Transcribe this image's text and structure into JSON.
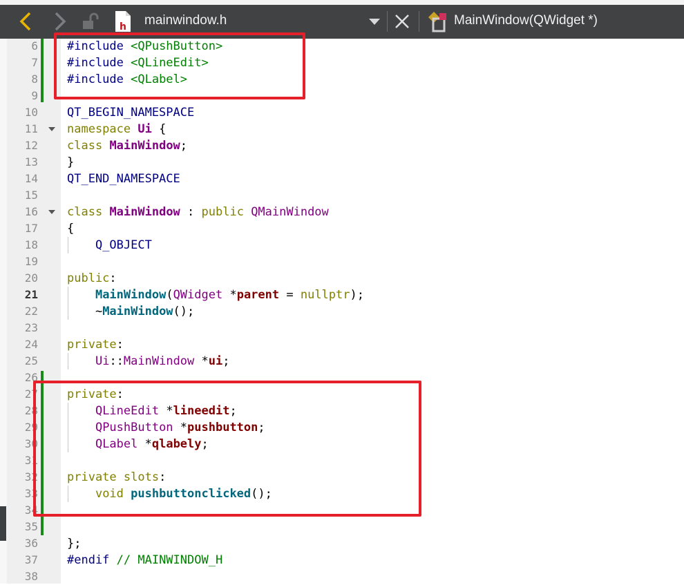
{
  "toolbar": {
    "file_name": "mainwindow.h",
    "symbol": "MainWindow(QWidget *)",
    "icons": [
      "back-arrow-icon",
      "forward-arrow-icon",
      "unlock-icon",
      "header-file-icon",
      "dropdown-icon",
      "close-icon",
      "class-symbol-icon"
    ]
  },
  "editor": {
    "current_line": 21,
    "lines": [
      {
        "n": "6",
        "code": "#include <QPushButton>"
      },
      {
        "n": "7",
        "code": "#include <QLineEdit>"
      },
      {
        "n": "8",
        "code": "#include <QLabel>"
      },
      {
        "n": "9",
        "code": ""
      },
      {
        "n": "10",
        "code": "QT_BEGIN_NAMESPACE"
      },
      {
        "n": "11",
        "code": "namespace Ui {"
      },
      {
        "n": "12",
        "code": "class MainWindow;"
      },
      {
        "n": "13",
        "code": "}"
      },
      {
        "n": "14",
        "code": "QT_END_NAMESPACE"
      },
      {
        "n": "15",
        "code": ""
      },
      {
        "n": "16",
        "code": "class MainWindow : public QMainWindow"
      },
      {
        "n": "17",
        "code": "{"
      },
      {
        "n": "18",
        "code": "    Q_OBJECT"
      },
      {
        "n": "19",
        "code": ""
      },
      {
        "n": "20",
        "code": "public:"
      },
      {
        "n": "21",
        "code": "    MainWindow(QWidget *parent = nullptr);"
      },
      {
        "n": "22",
        "code": "    ~MainWindow();"
      },
      {
        "n": "23",
        "code": ""
      },
      {
        "n": "24",
        "code": "private:"
      },
      {
        "n": "25",
        "code": "    Ui::MainWindow *ui;"
      },
      {
        "n": "26",
        "code": ""
      },
      {
        "n": "27",
        "code": "private:"
      },
      {
        "n": "28",
        "code": "    QLineEdit *lineedit;"
      },
      {
        "n": "29",
        "code": "    QPushButton *pushbutton;"
      },
      {
        "n": "30",
        "code": "    QLabel *qlabely;"
      },
      {
        "n": "31",
        "code": ""
      },
      {
        "n": "32",
        "code": "private slots:"
      },
      {
        "n": "33",
        "code": "    void pushbuttonclicked();"
      },
      {
        "n": "34",
        "code": ""
      },
      {
        "n": "35",
        "code": ""
      },
      {
        "n": "36",
        "code": "};"
      },
      {
        "n": "37",
        "code": "#endif // MAINWINDOW_H"
      },
      {
        "n": "38",
        "code": ""
      }
    ]
  },
  "colors": {
    "toolbar_bg": "#404244",
    "highlight_box": "#e6202a",
    "change_bar": "#1a8a1a",
    "keyword": "#808000",
    "type": "#800080",
    "member": "#800000",
    "function": "#00677c",
    "preprocessor": "#000080",
    "include_path": "#008000"
  }
}
